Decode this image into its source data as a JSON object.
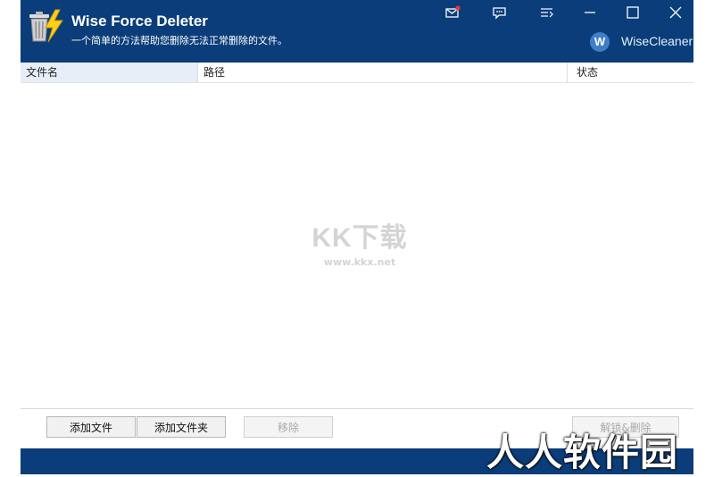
{
  "app": {
    "title": "Wise Force Deleter",
    "subtitle": "一个简单的方法帮助您删除无法正常删除的文件。",
    "brand": "WiseCleaner",
    "brand_logo_letter": "W"
  },
  "titlebar_buttons": [
    {
      "name": "mail-icon"
    },
    {
      "name": "feedback-icon"
    },
    {
      "name": "menu-icon"
    },
    {
      "name": "minimize-icon"
    },
    {
      "name": "maximize-icon"
    },
    {
      "name": "close-icon"
    }
  ],
  "table": {
    "columns": [
      "文件名",
      "路径",
      "状态"
    ],
    "rows": []
  },
  "buttons": {
    "add_file": "添加文件",
    "add_folder": "添加文件夹",
    "remove": "移除",
    "unlock_delete": "解锁&删除"
  },
  "watermarks": {
    "center_logo": "KK下载",
    "center_url": "www.kkx.net",
    "corner_text": "人人软件园"
  },
  "colors": {
    "titlebar": "#0a3d7a",
    "header_selected": "#e7eef8",
    "notification_dot": "#e53935"
  }
}
